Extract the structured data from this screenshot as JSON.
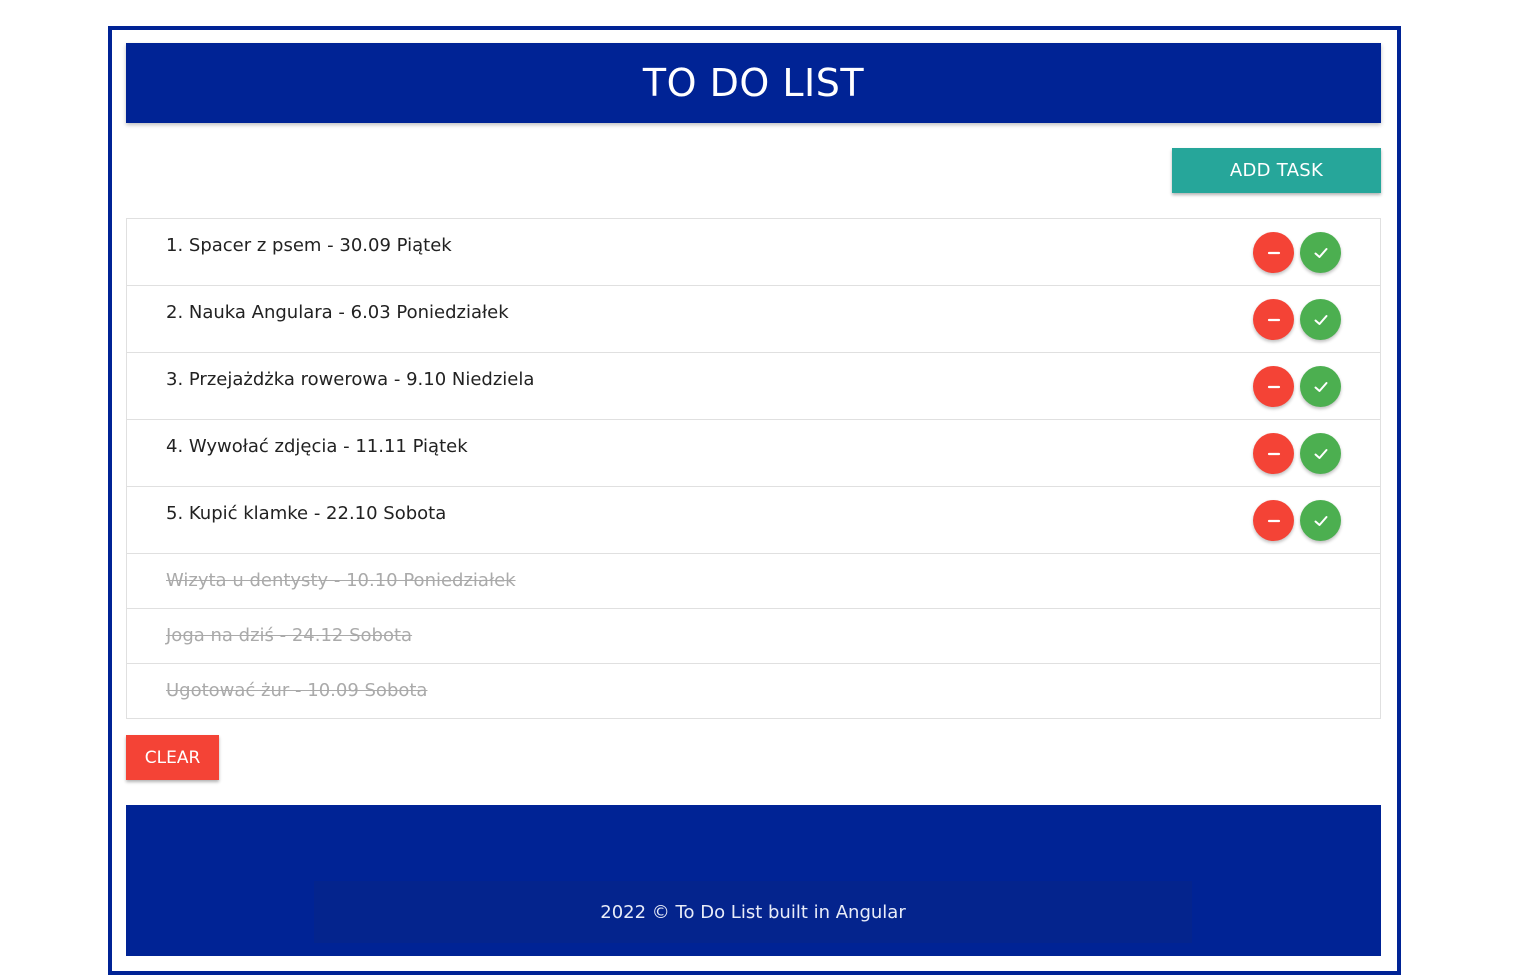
{
  "header": {
    "title": "TO DO LIST"
  },
  "toolbar": {
    "add_label": "ADD TASK",
    "clear_label": "CLEAR"
  },
  "tasks": [
    {
      "text": "1. Spacer z psem - 30.09 Piątek",
      "done": false
    },
    {
      "text": "2. Nauka Angulara - 6.03 Poniedziałek",
      "done": false
    },
    {
      "text": "3. Przejażdżka rowerowa - 9.10 Niedziela",
      "done": false
    },
    {
      "text": "4. Wywołać zdjęcia - 11.11 Piątek",
      "done": false
    },
    {
      "text": "5. Kupić klamke - 22.10 Sobota",
      "done": false
    },
    {
      "text": "Wizyta u dentysty - 10.10 Poniedziałek",
      "done": true
    },
    {
      "text": "Joga na dziś - 24.12 Sobota",
      "done": true
    },
    {
      "text": "Ugotować żur - 10.09 Sobota",
      "done": true
    }
  ],
  "icons": {
    "remove": "minus-icon",
    "complete": "check-icon"
  },
  "colors": {
    "brand": "#002395",
    "add": "#26a69a",
    "remove": "#f44336",
    "complete": "#4caf50"
  },
  "footer": {
    "text": "2022 © To Do List built in Angular"
  }
}
